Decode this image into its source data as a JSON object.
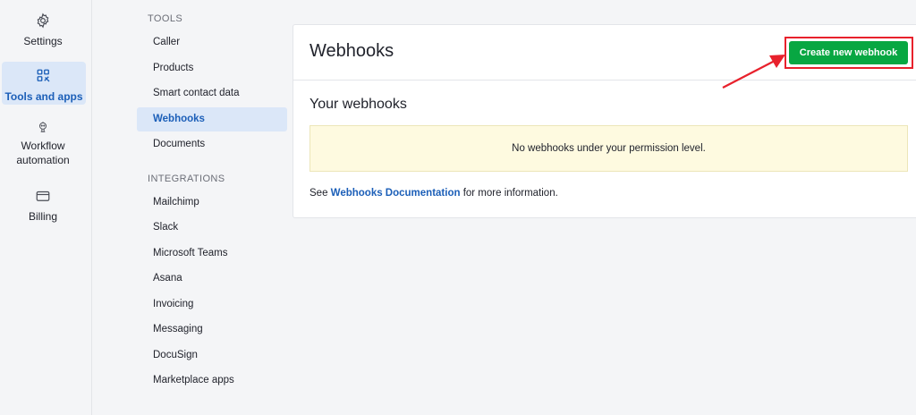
{
  "rail": {
    "items": [
      {
        "label_lines": [
          "Settings"
        ],
        "icon": "gear-icon"
      },
      {
        "label_lines": [
          "Tools and apps"
        ],
        "icon": "tools-apps-icon",
        "active": true
      },
      {
        "label_lines": [
          "Workflow",
          "automation"
        ],
        "icon": "robot-icon"
      },
      {
        "label_lines": [
          "Billing"
        ],
        "icon": "credit-card-icon"
      }
    ]
  },
  "subnav": {
    "tools_title": "TOOLS",
    "tools": [
      "Caller",
      "Products",
      "Smart contact data",
      "Webhooks",
      "Documents"
    ],
    "active_tool": "Webhooks",
    "integrations_title": "INTEGRATIONS",
    "integrations": [
      "Mailchimp",
      "Slack",
      "Microsoft Teams",
      "Asana",
      "Invoicing",
      "Messaging",
      "DocuSign",
      "Marketplace apps"
    ]
  },
  "main": {
    "title": "Webhooks",
    "create_button": "Create new webhook",
    "section_heading": "Your webhooks",
    "empty_message": "No webhooks under your permission level.",
    "info_prefix": "See ",
    "info_link": "Webhooks Documentation",
    "info_suffix": " for more information."
  },
  "colors": {
    "accent": "#1c5fb8",
    "button_green": "#08a742",
    "annotation_red": "#e8212c",
    "notice_bg": "#fefae0"
  }
}
